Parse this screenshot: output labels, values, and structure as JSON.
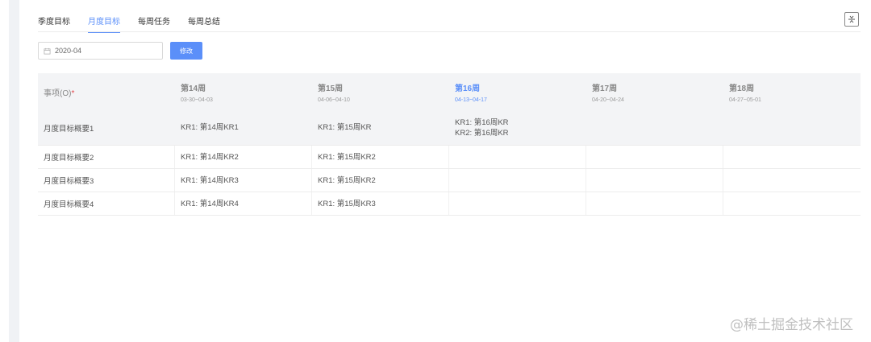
{
  "tabs": [
    {
      "label": "季度目标",
      "active": false
    },
    {
      "label": "月度目标",
      "active": true
    },
    {
      "label": "每周任务",
      "active": false
    },
    {
      "label": "每周总结",
      "active": false
    }
  ],
  "toolbar": {
    "date_value": "2020-04",
    "edit_label": "修改"
  },
  "table": {
    "first_col": {
      "label": "事项(O)",
      "required_mark": "*"
    },
    "weeks": [
      {
        "week": "第14周",
        "range": "03-30~04-03",
        "current": false
      },
      {
        "week": "第15周",
        "range": "04-06~04-10",
        "current": false
      },
      {
        "week": "第16周",
        "range": "04-13~04-17",
        "current": true
      },
      {
        "week": "第17周",
        "range": "04-20~04-24",
        "current": false
      },
      {
        "week": "第18周",
        "range": "04-27~05-01",
        "current": false
      }
    ],
    "rows": [
      {
        "item": "月度目标概要1",
        "cells": [
          [
            "KR1: 第14周KR1"
          ],
          [
            "KR1: 第15周KR"
          ],
          [
            "KR1: 第16周KR",
            "KR2: 第16周KR"
          ],
          [],
          []
        ]
      },
      {
        "item": "月度目标概要2",
        "cells": [
          [
            "KR1: 第14周KR2"
          ],
          [
            "KR1: 第15周KR2"
          ],
          [],
          [],
          []
        ]
      },
      {
        "item": "月度目标概要3",
        "cells": [
          [
            "KR1: 第14周KR3"
          ],
          [
            "KR1: 第15周KR2"
          ],
          [],
          [],
          []
        ]
      },
      {
        "item": "月度目标概要4",
        "cells": [
          [
            "KR1: 第14周KR4"
          ],
          [
            "KR1: 第15周KR3"
          ],
          [],
          [],
          []
        ]
      }
    ]
  },
  "watermark": "@稀土掘金技术社区",
  "colors": {
    "accent": "#5b8ff9",
    "required": "#e5484d",
    "header_bg": "#f3f4f6"
  },
  "icons": {
    "date": "calendar-icon",
    "collapse": "collapse-icon"
  }
}
